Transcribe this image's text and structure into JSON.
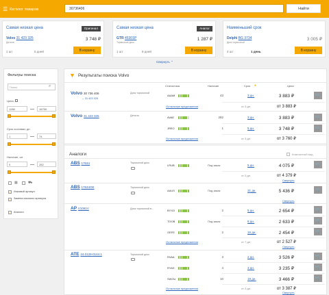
{
  "header": {
    "catalog_label": "Каталог товаров",
    "search_value": "30736406",
    "find_label": "Найти"
  },
  "cards": [
    {
      "title": "Самая низкая цена",
      "tag": "Оригинал",
      "brand": "Volvo",
      "article": "31 423 325",
      "sub": "Детали",
      "price": "3 748 ₽",
      "qty": "1 шт",
      "days": "5 дней",
      "cart": "В корзину"
    },
    {
      "title": "Самая низкая цена",
      "tag": "Аналог",
      "brand": "GTR",
      "article": "45301P",
      "sub": "Тормозной диск",
      "price": "1 287 ₽",
      "qty": "1 шт",
      "days": "8 дней",
      "cart": "В корзину"
    },
    {
      "title": "Наименьший срок",
      "tag": "",
      "brand": "Delphi",
      "article": "BG 3734",
      "sub": "Диск тормозной",
      "price": "3 005 ₽",
      "qty": "4 шт",
      "days": "1 день",
      "cart": "В корзину"
    }
  ],
  "collapse_label": "Свернуть",
  "filters": {
    "title": "Фильтры поиска",
    "search_placeholder": "Поиск",
    "price_label": "Цена,",
    "price_from": "1280",
    "price_to": "16759",
    "term_label": "Срок поставки, дн.",
    "term_from": "1",
    "term_to": "74",
    "stock_label": "Наличие, шт",
    "stock_from": "0",
    "stock_to": "282",
    "checks": [
      {
        "label": "Искомый артикул",
        "checked": true
      },
      {
        "label": "Замена искомого артикула",
        "checked": true
      },
      {
        "label": "Аналоги",
        "checked": true
      }
    ]
  },
  "results": {
    "title": "Результаты поиска Volvo",
    "columns": {
      "stat": "Статистика",
      "stock": "Наличие",
      "term": "Срок",
      "price": "Цена"
    },
    "original": [
      {
        "brand": "Volvo",
        "article": "30 736 406",
        "article2": "→ 31 423 325",
        "desc": "Диск тормозной",
        "supplier": "AAAM",
        "stock": "43",
        "term": "3 дн.",
        "price": "3 883 ₽",
        "other": "Остальные предложения",
        "from_term": "от 3 дн.",
        "from_price": "от 3 883 ₽"
      },
      {
        "brand": "Volvo",
        "article": "31 423 325",
        "desc": "Детали",
        "rows": [
          {
            "supplier": "AVAE",
            "stock": "282",
            "term": "3 дн.",
            "price": "3 883 ₽"
          },
          {
            "supplier": "JREO",
            "stock": "1",
            "term": "5 дн.",
            "price": "3 748 ₽"
          }
        ],
        "other": "Остальные предложения",
        "from_term": "от 3 дн.",
        "from_price": "от 3 760 ₽"
      }
    ],
    "analogs_title": "Аналоги",
    "compact_label": "Компактный вид",
    "analogs": [
      {
        "brand": "ABS",
        "article": "17634",
        "desc": "Тормозной диск",
        "supplier": "LRUB",
        "stock": "Под заказ",
        "term": "5 дн.",
        "price": "4 075 ₽",
        "from_term": "от 3 дн.",
        "from_price": "от 4 379 ₽",
        "collapse": "Свернуть"
      },
      {
        "brand": "ABS",
        "article": "17634OE",
        "desc": "Тормозной диск",
        "supplier": "AAUS",
        "stock": "Под заказ",
        "term": "31 дн.",
        "price": "5 436 ₽",
        "from_term": "",
        "from_price": "",
        "collapse": "Свернуть"
      },
      {
        "brand": "AP",
        "article": "V1061V",
        "desc": "Диск тормозной в...",
        "rows": [
          {
            "supplier": "BYXO",
            "stock": "2",
            "term": "5 дн.",
            "price": "2 654 ₽"
          },
          {
            "supplier": "TOOB",
            "stock": "Под заказ",
            "term": "6 дн.",
            "price": "2 633 ₽"
          },
          {
            "supplier": "GEFE",
            "stock": "2",
            "term": "16 дн.",
            "price": "2 454 ₽"
          }
        ],
        "other": "Остальные предложения",
        "from_term": "от 7 дн.",
        "from_price": "от 2 527 ₽",
        "collapse": "Свернуть"
      },
      {
        "brand": "ATE",
        "article": "24.0129-0144.1",
        "desc": "Тормозной диск",
        "rows": [
          {
            "supplier": "RVAA",
            "stock": "3",
            "term": "2 дн.",
            "price": "3 526 ₽"
          },
          {
            "supplier": "RYAS",
            "stock": "4",
            "term": "3 дн.",
            "price": "3 235 ₽"
          },
          {
            "supplier": "SWOU",
            "stock": "10",
            "term": "19 дн.",
            "price": "3 466 ₽"
          }
        ],
        "other": "Остальные предложения",
        "from_term": "от 3 дн.",
        "from_price": "от 3 387 ₽",
        "collapse": "Свернуть"
      }
    ]
  },
  "colors": {
    "accent": "#f5a800",
    "link": "#2b64b8",
    "stat": "#8bc34a"
  }
}
